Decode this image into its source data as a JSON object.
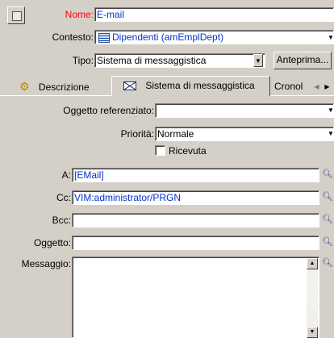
{
  "header": {
    "nome_label": "Nome:",
    "nome_value": "E-mail",
    "contesto_label": "Contesto:",
    "contesto_value": "Dipendenti (amEmplDept)",
    "tipo_label": "Tipo:",
    "tipo_value": "Sistema di messaggistica",
    "preview_button": "Anteprima..."
  },
  "tabs": [
    {
      "label": "Descrizione",
      "icon": "gears-icon"
    },
    {
      "label": "Sistema di messaggistica",
      "icon": "envelope-icon"
    },
    {
      "label": "Cronol"
    }
  ],
  "form": {
    "oggetto_ref_label": "Oggetto referenziato:",
    "oggetto_ref_value": "",
    "priorita_label": "Priorità:",
    "priorita_value": "Normale",
    "ricevuta_label": "Ricevuta",
    "ricevuta_checked": false,
    "a_label": "A:",
    "a_value": "[EMail]",
    "cc_label": "Cc:",
    "cc_value": "VIM:administrator/PRGN",
    "bcc_label": "Bcc:",
    "bcc_value": "",
    "oggetto_label": "Oggetto:",
    "oggetto_value": "",
    "messaggio_label": "Messaggio:",
    "messaggio_value": ""
  },
  "colors": {
    "required_label": "#ff0000",
    "value_text": "#0033cc",
    "window_bg": "#d4d0c8"
  }
}
